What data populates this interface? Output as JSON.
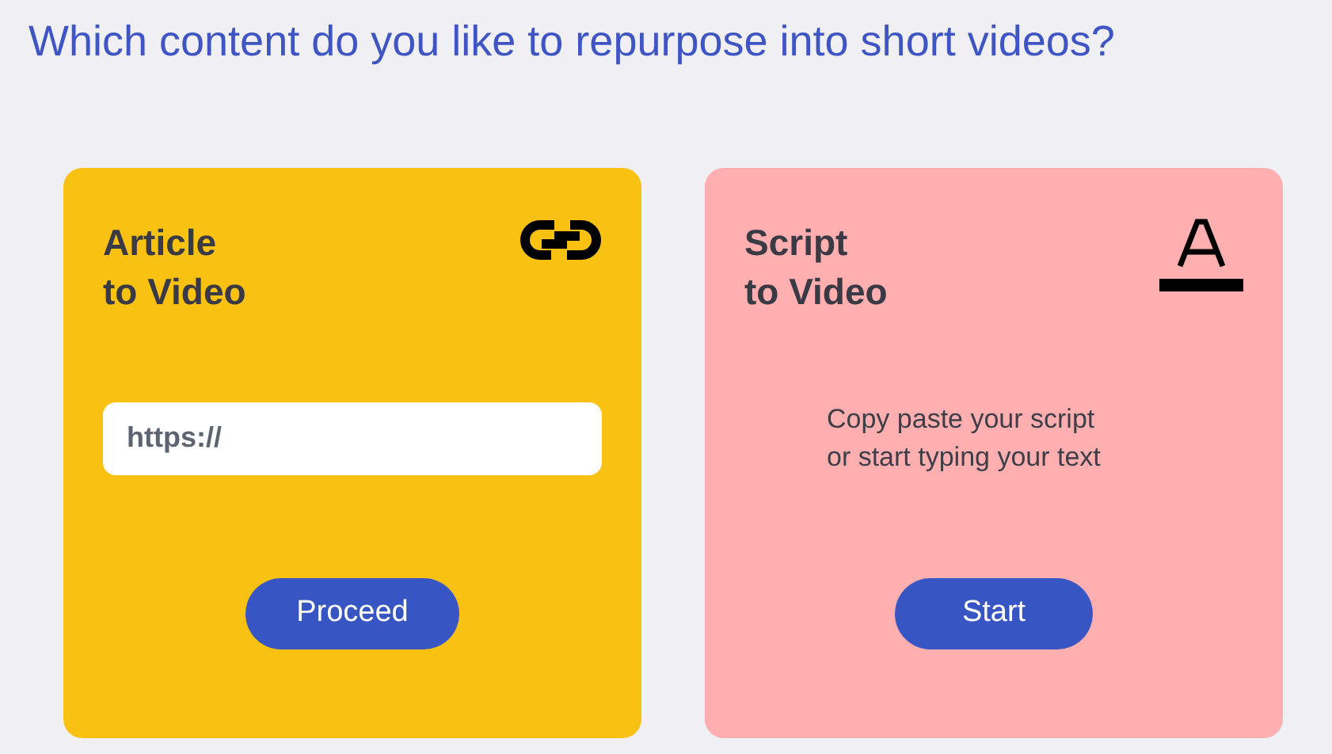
{
  "heading": "Which content do you like to repurpose into short videos?",
  "cards": [
    {
      "kind": "article",
      "color": "#f9c213",
      "title_lines": [
        "Article",
        "to Video"
      ],
      "input": {
        "placeholder": "https://"
      },
      "button": "Proceed"
    },
    {
      "kind": "script",
      "color": "#ffafaf",
      "title_lines": [
        "Script",
        "to Video"
      ],
      "description_lines": [
        "Copy paste your script",
        "or start typing your text"
      ],
      "button": "Start"
    }
  ]
}
